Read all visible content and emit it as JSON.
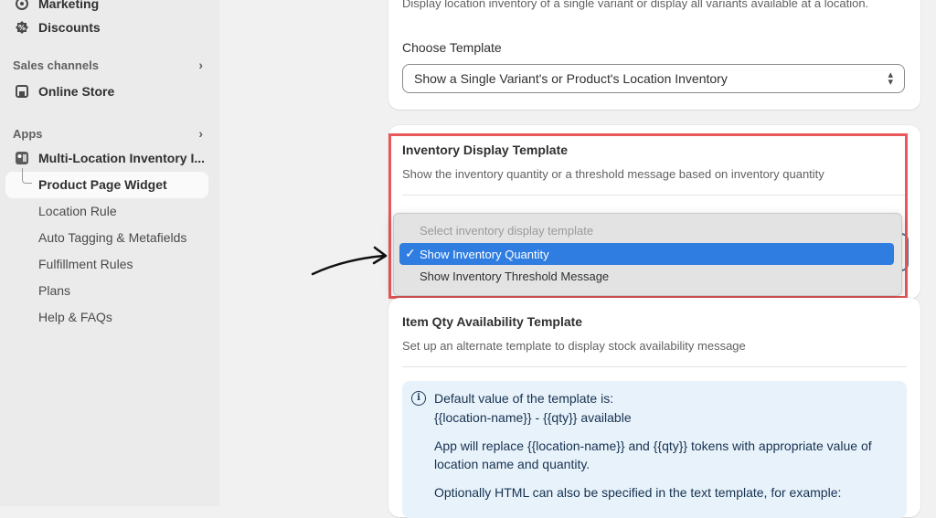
{
  "sidebar": {
    "marketing": "Marketing",
    "discounts": "Discounts",
    "sales_channels": "Sales channels",
    "online_store": "Online Store",
    "apps": "Apps",
    "app_name": "Multi-Location Inventory I...",
    "sub_items": [
      "Product Page Widget",
      "Location Rule",
      "Auto Tagging & Metafields",
      "Fulfillment Rules",
      "Plans",
      "Help & FAQs"
    ]
  },
  "card1": {
    "description": "Display location inventory of a single variant or display all variants available at a location.",
    "choose_label": "Choose Template",
    "choose_value": "Show a Single Variant's or Product's Location Inventory"
  },
  "card2": {
    "title": "Inventory Display Template",
    "description": "Show the inventory quantity or a threshold message based on inventory quantity",
    "dropdown": {
      "placeholder": "Select inventory display template",
      "options": [
        "Show Inventory Quantity",
        "Show Inventory Threshold Message"
      ],
      "selected": "Show Inventory Quantity"
    }
  },
  "card3": {
    "title": "Item Qty Availability Template",
    "description": "Set up an alternate template to display stock availability message",
    "info": {
      "line1": "Default value of the template is:",
      "line2": "{{location-name}} - {{qty}} available",
      "line3": "App will replace {{location-name}} and {{qty}} tokens with appropriate value of location name and quantity.",
      "line4": "Optionally HTML can also be specified in the text template, for example:"
    }
  },
  "colors": {
    "highlight": "#e8585a",
    "selected_option": "#2f7de1",
    "info_bg": "#e8f2fb"
  }
}
